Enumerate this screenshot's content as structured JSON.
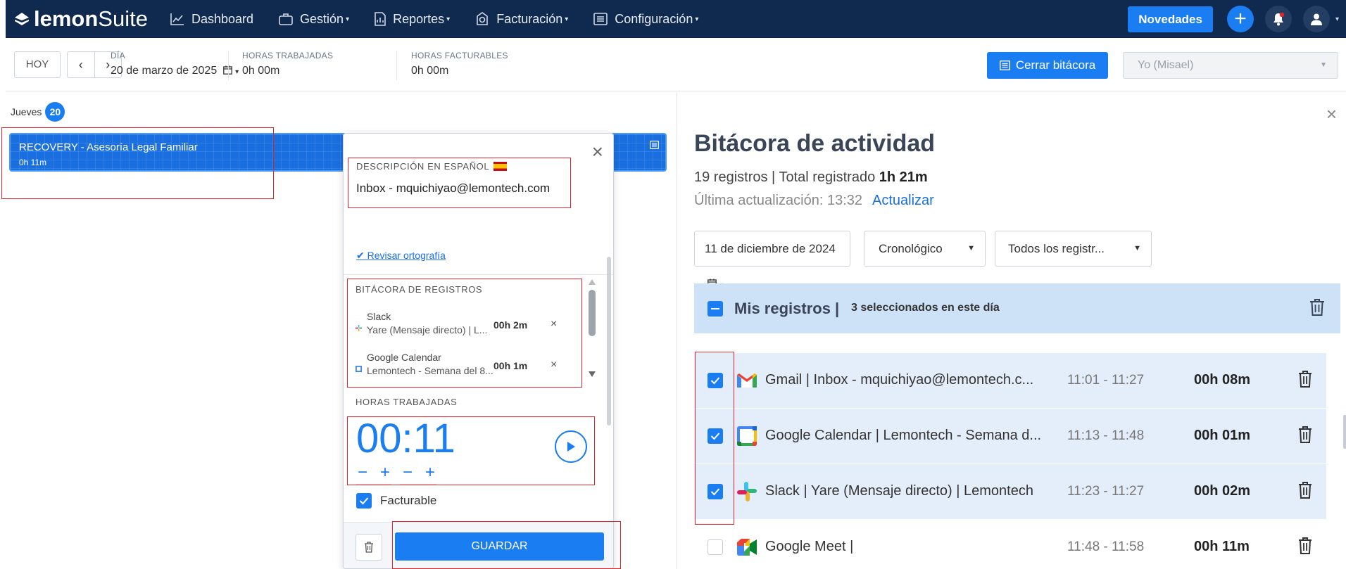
{
  "nav": {
    "brand_bold": "lemon",
    "brand_light": "Suite",
    "items": [
      {
        "label": "Dashboard",
        "icon": "chart-line-icon",
        "caret": false
      },
      {
        "label": "Gestión",
        "icon": "briefcase-icon",
        "caret": true
      },
      {
        "label": "Reportes",
        "icon": "report-icon",
        "caret": true
      },
      {
        "label": "Facturación",
        "icon": "money-icon",
        "caret": true
      },
      {
        "label": "Configuración",
        "icon": "list-icon",
        "caret": true
      }
    ],
    "novedades": "Novedades"
  },
  "toolbar": {
    "hoy": "HOY",
    "dia_label": "DÍA",
    "dia_value": "20 de marzo de 2025",
    "horas_trabajadas_label": "HORAS TRABAJADAS",
    "horas_trabajadas_value": "0h 00m",
    "horas_facturables_label": "HORAS FACTURABLES",
    "horas_facturables_value": "0h 00m",
    "cerrar_bitacora": "Cerrar bitácora",
    "user_select": "Yo (Misael)"
  },
  "calendar": {
    "day_name": "Jueves",
    "day_number": "20",
    "event_title": "RECOVERY - Asesoría Legal Familiar",
    "event_duration": "0h 11m"
  },
  "popup": {
    "desc_label": "DESCRIPCIÓN EN ESPAÑOL",
    "desc_value": "Inbox - mquichiyao@lemontech.com",
    "spell_check": "Revisar ortografía",
    "bitacora_label": "BITÁCORA DE REGISTROS",
    "registros": [
      {
        "name": "Slack",
        "sub": "Yare (Mensaje directo) | L...",
        "time": "00h 2m"
      },
      {
        "name": "Google Calendar",
        "sub": "Lemontech - Semana del 8...",
        "time": "00h 1m"
      }
    ],
    "horas_label": "HORAS TRABAJADAS",
    "timer_h": "00",
    "timer_m": "11",
    "facturable": "Facturable",
    "guardar": "GUARDAR"
  },
  "panel": {
    "title": "Bitácora de actividad",
    "count": "19 registros",
    "total_label": "Total registrado",
    "total_value": "1h 21m",
    "last_update": "Última actualización: 13:32",
    "refresh": "Actualizar",
    "date_filter": "11 de diciembre de 2024",
    "order_filter": "Cronológico",
    "type_filter": "Todos los registr...",
    "mis_registros": "Mis registros",
    "selected_text": "3 seleccionados en este día",
    "rows": [
      {
        "app": "gmail",
        "name": "Gmail | Inbox - mquichiyao@lemontech.c...",
        "hours": "11:01 - 11:27",
        "duration": "00h 08m",
        "checked": true
      },
      {
        "app": "google-calendar",
        "name": "Google Calendar | Lemontech - Semana d...",
        "hours": "11:13 - 11:48",
        "duration": "00h 01m",
        "checked": true
      },
      {
        "app": "slack",
        "name": "Slack | Yare (Mensaje directo) | Lemontech",
        "hours": "11:23 - 11:27",
        "duration": "00h 02m",
        "checked": true
      },
      {
        "app": "google-meet",
        "name": "Google Meet |",
        "hours": "11:48 - 11:58",
        "duration": "00h 11m",
        "checked": false
      }
    ]
  },
  "colors": {
    "nav_bg": "#0f2a4e",
    "accent": "#1a7df2",
    "selected_row": "#e4eefb",
    "annotation_red": "#e0242c"
  }
}
